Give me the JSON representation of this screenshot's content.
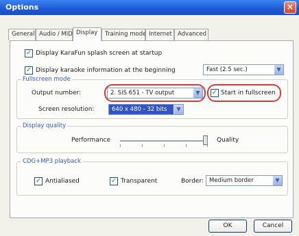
{
  "window": {
    "title": "Options",
    "close_glyph": "×"
  },
  "tabs": [
    {
      "label": "General"
    },
    {
      "label": "Audio / MIDI"
    },
    {
      "label": "Display"
    },
    {
      "label": "Training mode"
    },
    {
      "label": "Internet"
    },
    {
      "label": "Advanced"
    }
  ],
  "active_tab": "Display",
  "display": {
    "splash_checkbox": {
      "label": "Display KaraFun splash screen at startup",
      "checked": true
    },
    "info_checkbox": {
      "label": "Display karaoke information at the beginning",
      "checked": true
    },
    "info_duration": {
      "value": "Fast (2.5 sec.)"
    },
    "fullscreen": {
      "group_title": "Fullscreen mode",
      "output_label": "Output number:",
      "output_value": "2. SiS 651 - TV output",
      "start_checkbox": {
        "label": "Start in fullscreen",
        "checked": true
      },
      "resolution_label": "Screen resolution:",
      "resolution_value": "640 x 480 - 32 bits"
    },
    "quality": {
      "group_title": "Display quality",
      "left_label": "Performance",
      "right_label": "Quality",
      "level": 1.0
    },
    "cdg": {
      "group_title": "CDG+MP3 playback",
      "antialiased": {
        "label": "Antialiased",
        "checked": true
      },
      "transparent": {
        "label": "Transparent",
        "checked": true
      },
      "border_label": "Border:",
      "border_value": "Medium border"
    }
  },
  "buttons": {
    "ok": "OK",
    "cancel": "Cancel"
  },
  "check_glyph": "✓",
  "dropdown_glyph": "▼",
  "annotation_color": "#d73b33"
}
